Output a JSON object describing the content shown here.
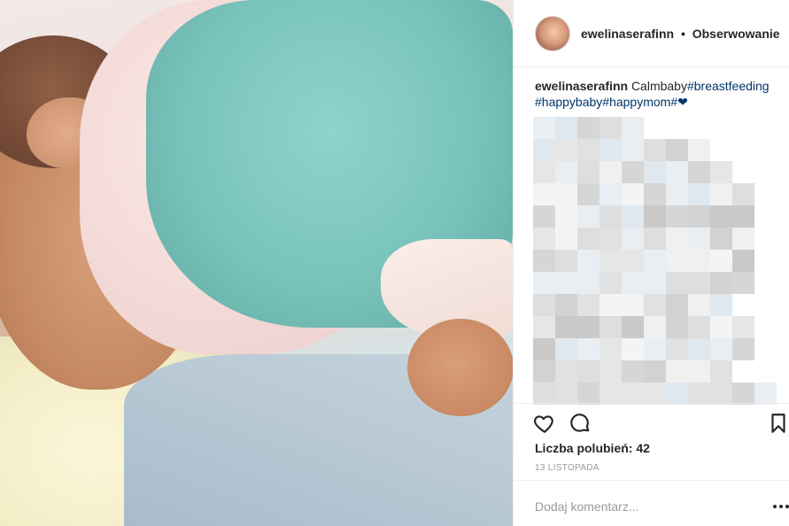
{
  "post": {
    "username": "ewelinaserafinn",
    "separator": "•",
    "follow_status": "Obserwowanie",
    "caption_user": "ewelinaserafinn",
    "caption_text": "Calmbaby",
    "caption_tags": "#breastfeeding#happybaby#happymom#",
    "caption_emoji": "❤",
    "likes_label": "Liczba polubień: 42",
    "date_label": "13 LISTOPADA",
    "comment_placeholder": "Dodaj komentarz...",
    "more_label": "..."
  },
  "icons": {
    "like": "heart-outline-icon",
    "comment": "speech-bubble-icon",
    "save": "bookmark-icon",
    "more": "more-options-icon"
  },
  "colors": {
    "hashtag": "#003569",
    "text": "#262626",
    "muted": "#999999",
    "divider": "#efefef"
  }
}
